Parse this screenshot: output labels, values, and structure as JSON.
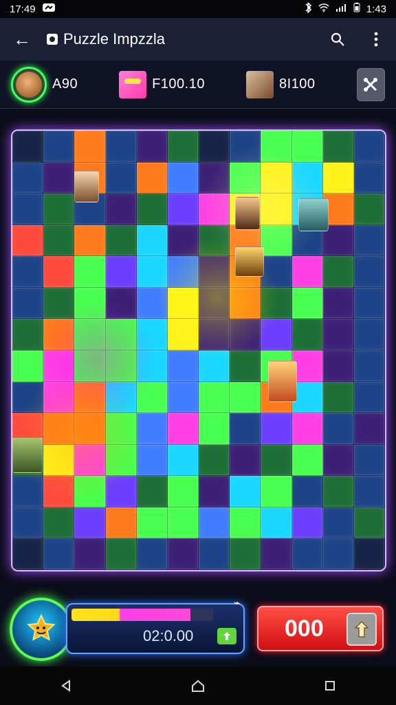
{
  "status": {
    "time_left": "17:49",
    "time_right": "1:43"
  },
  "app": {
    "title": "Puzzle Impzzla"
  },
  "players": [
    {
      "score": "A90"
    },
    {
      "score": "F100.10"
    },
    {
      "score": "8I100"
    }
  ],
  "board": {
    "cols": 12,
    "rows": 14,
    "palette": {
      "blue": "#3f7cff",
      "green": "#47ff4e",
      "teal": "#19d7ff",
      "magenta": "#ff3fe4",
      "orange": "#ff7a1b",
      "yellow": "#fff21b",
      "purple": "#6b3dff",
      "darkBlue": "#1c4387",
      "darkGreen": "#1d6d36",
      "darkPurple": "#3b2075",
      "red": "#ff4a3d",
      "navy": "#162346"
    }
  },
  "footer": {
    "timer": "02:0.00",
    "progress_fraction": 0.84,
    "coin_value": "000"
  }
}
